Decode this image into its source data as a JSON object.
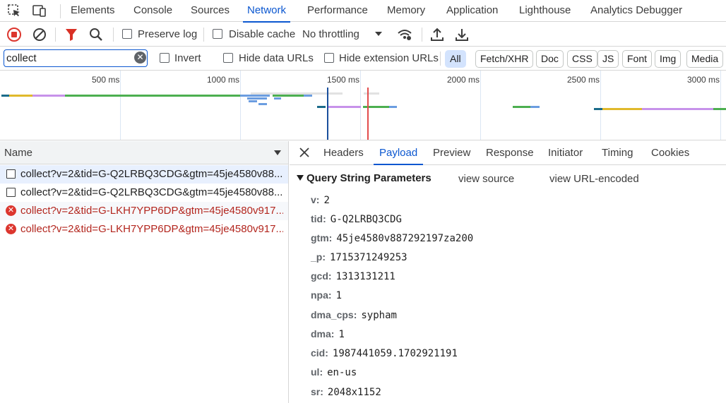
{
  "tabbar": {
    "tabs": [
      "Elements",
      "Console",
      "Sources",
      "Network",
      "Performance",
      "Memory",
      "Application",
      "Lighthouse",
      "Analytics Debugger"
    ],
    "active": "Network"
  },
  "toolbar": {
    "preserve_log": "Preserve log",
    "disable_cache": "Disable cache",
    "throttling": "No throttling"
  },
  "filter": {
    "value": "collect",
    "invert": "Invert",
    "hide_data_urls": "Hide data URLs",
    "hide_extension_urls": "Hide extension URLs",
    "types": [
      "All",
      "Fetch/XHR",
      "Doc",
      "CSS",
      "JS",
      "Font",
      "Img",
      "Media"
    ],
    "active_type": "All"
  },
  "overview": {
    "ruler": [
      "500 ms",
      "1000 ms",
      "1500 ms",
      "2000 ms",
      "2500 ms",
      "3000 ms"
    ]
  },
  "requests": {
    "column": "Name",
    "rows": [
      {
        "name": "collect?v=2&tid=G-Q2LRBQ3CDG&gtm=45je4580v88...",
        "status": "ok",
        "selected": true
      },
      {
        "name": "collect?v=2&tid=G-Q2LRBQ3CDG&gtm=45je4580v88...",
        "status": "ok",
        "selected": false
      },
      {
        "name": "collect?v=2&tid=G-LKH7YPP6DP&gtm=45je4580v917...",
        "status": "error",
        "selected": false
      },
      {
        "name": "collect?v=2&tid=G-LKH7YPP6DP&gtm=45je4580v917...",
        "status": "error",
        "selected": false
      }
    ]
  },
  "detail": {
    "tabs": [
      "Headers",
      "Payload",
      "Preview",
      "Response",
      "Initiator",
      "Timing",
      "Cookies"
    ],
    "active": "Payload",
    "section_title": "Query String Parameters",
    "view_source": "view source",
    "view_url_encoded": "view URL-encoded",
    "params": [
      {
        "key": "v:",
        "value": "2"
      },
      {
        "key": "tid:",
        "value": "G-Q2LRBQ3CDG"
      },
      {
        "key": "gtm:",
        "value": "45je4580v887292197za200"
      },
      {
        "key": "_p:",
        "value": "1715371249253"
      },
      {
        "key": "gcd:",
        "value": "1313131211"
      },
      {
        "key": "npa:",
        "value": "1"
      },
      {
        "key": "dma_cps:",
        "value": "sypham"
      },
      {
        "key": "dma:",
        "value": "1"
      },
      {
        "key": "cid:",
        "value": "1987441059.1702921191"
      },
      {
        "key": "ul:",
        "value": "en-us"
      },
      {
        "key": "sr:",
        "value": "2048x1152"
      }
    ]
  },
  "colors": {
    "accent": "#0b57d0",
    "record_red": "#dc362e",
    "filter_red": "#d93025",
    "error_text": "#b3261e",
    "dom_content_loaded": "#1a4f9c",
    "load": "#e34c4c"
  }
}
